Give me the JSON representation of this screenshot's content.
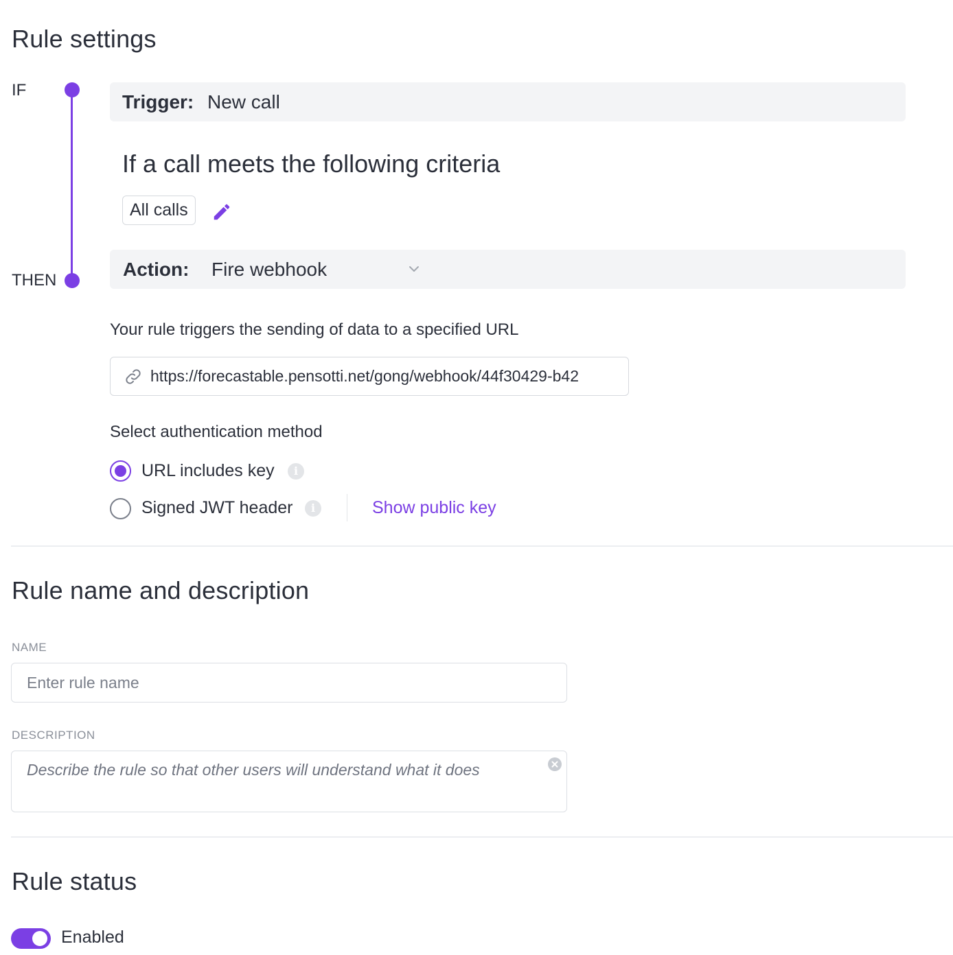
{
  "rule_settings": {
    "title": "Rule settings",
    "if_label": "IF",
    "then_label": "THEN",
    "trigger": {
      "key": "Trigger:",
      "value": "New call"
    },
    "criteria": {
      "title": "If a call meets the following criteria",
      "chip": "All calls"
    },
    "action": {
      "key": "Action:",
      "value": "Fire webhook"
    },
    "webhook": {
      "description": "Your rule triggers the sending of data to a specified URL",
      "url": "https://forecastable.pensotti.net/gong/webhook/44f30429-b42"
    },
    "auth": {
      "label": "Select authentication method",
      "options": [
        {
          "label": "URL includes key",
          "selected": true
        },
        {
          "label": "Signed JWT header",
          "selected": false
        }
      ],
      "show_public_key": "Show public key"
    }
  },
  "rule_name": {
    "title": "Rule name and description",
    "name_label": "NAME",
    "name_placeholder": "Enter rule name",
    "description_label": "DESCRIPTION",
    "description_placeholder": "Describe the rule so that other users will understand what it does"
  },
  "rule_status": {
    "title": "Rule status",
    "toggle_label": "Enabled",
    "enabled": true
  },
  "colors": {
    "accent": "#7b3fe4",
    "bar_bg": "#f3f4f6",
    "text": "#2b2f3a"
  }
}
